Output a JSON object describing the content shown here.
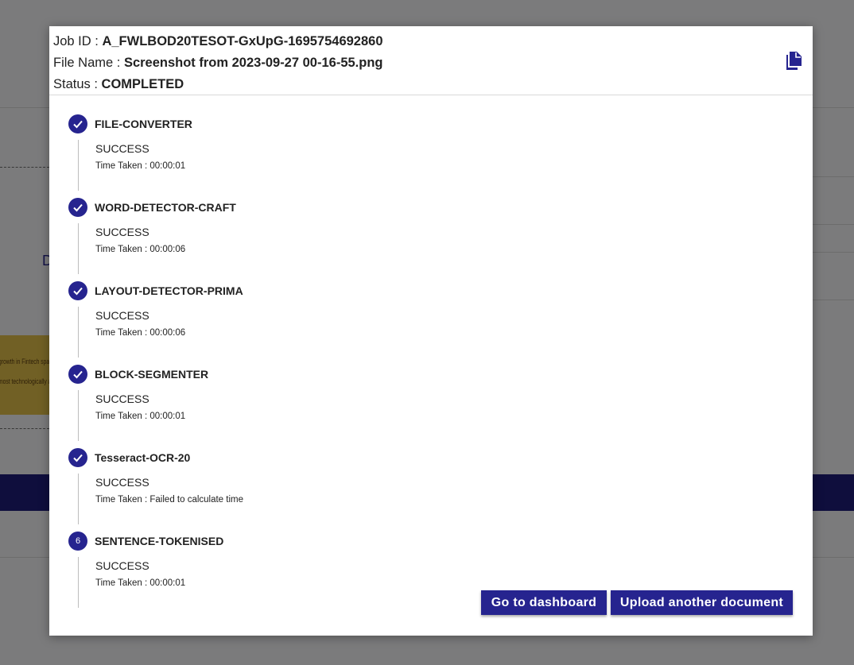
{
  "background": {
    "partial_letter": "D",
    "thumb_lines": [
      "growth in Fintech space has",
      "most technologically advan"
    ]
  },
  "modal": {
    "job_id_label": "Job ID : ",
    "job_id_value": "A_FWLBOD20TESOT-GxUpG-1695754692860",
    "file_name_label": "File Name : ",
    "file_name_value": "Screenshot from 2023-09-27 00-16-55.png",
    "status_label": "Status : ",
    "status_value": "COMPLETED",
    "copy_icon": "copy-icon",
    "steps": [
      {
        "badge": "check-icon",
        "title": "FILE-CONVERTER",
        "status": "SUCCESS",
        "time": "Time Taken : 00:00:01"
      },
      {
        "badge": "check-icon",
        "title": "WORD-DETECTOR-CRAFT",
        "status": "SUCCESS",
        "time": "Time Taken : 00:00:06"
      },
      {
        "badge": "check-icon",
        "title": "LAYOUT-DETECTOR-PRIMA",
        "status": "SUCCESS",
        "time": "Time Taken : 00:00:06"
      },
      {
        "badge": "check-icon",
        "title": "BLOCK-SEGMENTER",
        "status": "SUCCESS",
        "time": "Time Taken : 00:00:01"
      },
      {
        "badge": "check-icon",
        "title": "Tesseract-OCR-20",
        "status": "SUCCESS",
        "time": "Time Taken : Failed to calculate time"
      },
      {
        "badge": "6",
        "title": "SENTENCE-TOKENISED",
        "status": "SUCCESS",
        "time": "Time Taken : 00:00:01"
      }
    ],
    "buttons": {
      "dashboard": "Go to dashboard",
      "upload": "Upload another document"
    }
  },
  "colors": {
    "accent": "#26248f",
    "overlay": "rgba(0,0,0,0.5)"
  }
}
